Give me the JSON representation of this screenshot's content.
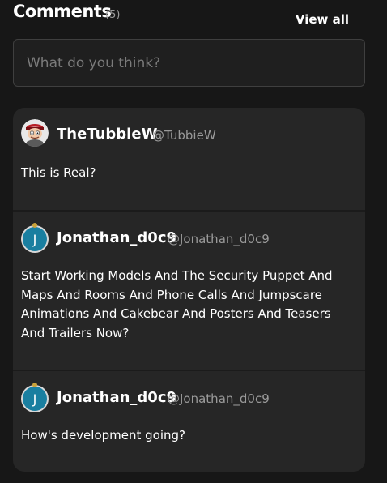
{
  "header": {
    "title": "Comments",
    "count": "(5)",
    "view_all": "View all"
  },
  "input": {
    "placeholder": "What do you think?"
  },
  "comments": [
    {
      "name": "TheTubbieW",
      "handle": "@TubbieW",
      "avatar": "cartoon-avatar",
      "text": "This is Real?"
    },
    {
      "name": "Jonathan_d0c9",
      "handle": "@Jonathan_d0c9",
      "avatar_letter": "J",
      "text": "Start Working Models And The Security Puppet And Maps And Rooms And Phone Calls And Jumpscare Animations And Cakebear And Posters And Teasers And Trailers Now?"
    },
    {
      "name": "Jonathan_d0c9",
      "handle": "@Jonathan_d0c9",
      "avatar_letter": "J",
      "text": "How's development going?"
    }
  ],
  "colors": {
    "background": "#171717",
    "panel": "#262626",
    "muted": "#9a9a9a",
    "avatar_teal": "#1a7fa0"
  }
}
